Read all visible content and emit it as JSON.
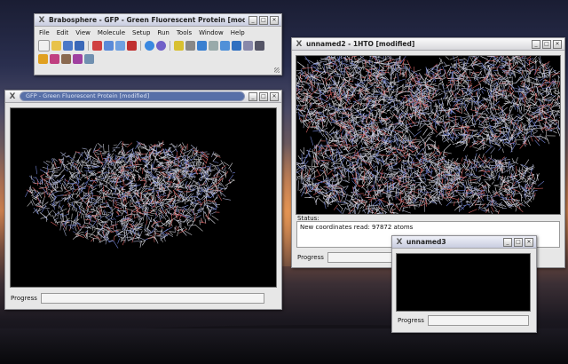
{
  "main_window": {
    "title": "Brabosphere - GFP - Green Fluorescent Protein [modified]",
    "menu": [
      "File",
      "Edit",
      "View",
      "Molecule",
      "Setup",
      "Run",
      "Tools",
      "Window",
      "Help"
    ],
    "toolbar_row1": [
      "new-icon",
      "open-icon",
      "save-icon",
      "save-all-icon",
      "cut-icon",
      "copy-icon",
      "paste-icon",
      "delete-icon",
      "info-icon",
      "settings-icon",
      "run-icon",
      "stop-icon",
      "view-icon",
      "camera-icon",
      "grid-icon",
      "render-icon",
      "measure-icon",
      "atom-icon"
    ],
    "toolbar_row2": [
      "select-icon",
      "brush-icon",
      "tool-icon",
      "flag-icon",
      "export-icon"
    ]
  },
  "gfp_window": {
    "title": "GFP - Green Fluorescent Protein [modified]",
    "progress_label": "Progress"
  },
  "unnamed2_window": {
    "title": "unnamed2 - 1HTO [modified]",
    "status_label": "Status:",
    "status_text": "New coordinates read: 97872 atoms",
    "progress_label": "Progress"
  },
  "unnamed3_window": {
    "title": "unnamed3",
    "progress_label": "Progress"
  },
  "title_buttons": [
    "_",
    "□",
    "✕"
  ],
  "colors": {
    "viewport_bg": "#000000",
    "pill_bg": "#5870a8",
    "chrome_bg": "#e7e7e7"
  }
}
